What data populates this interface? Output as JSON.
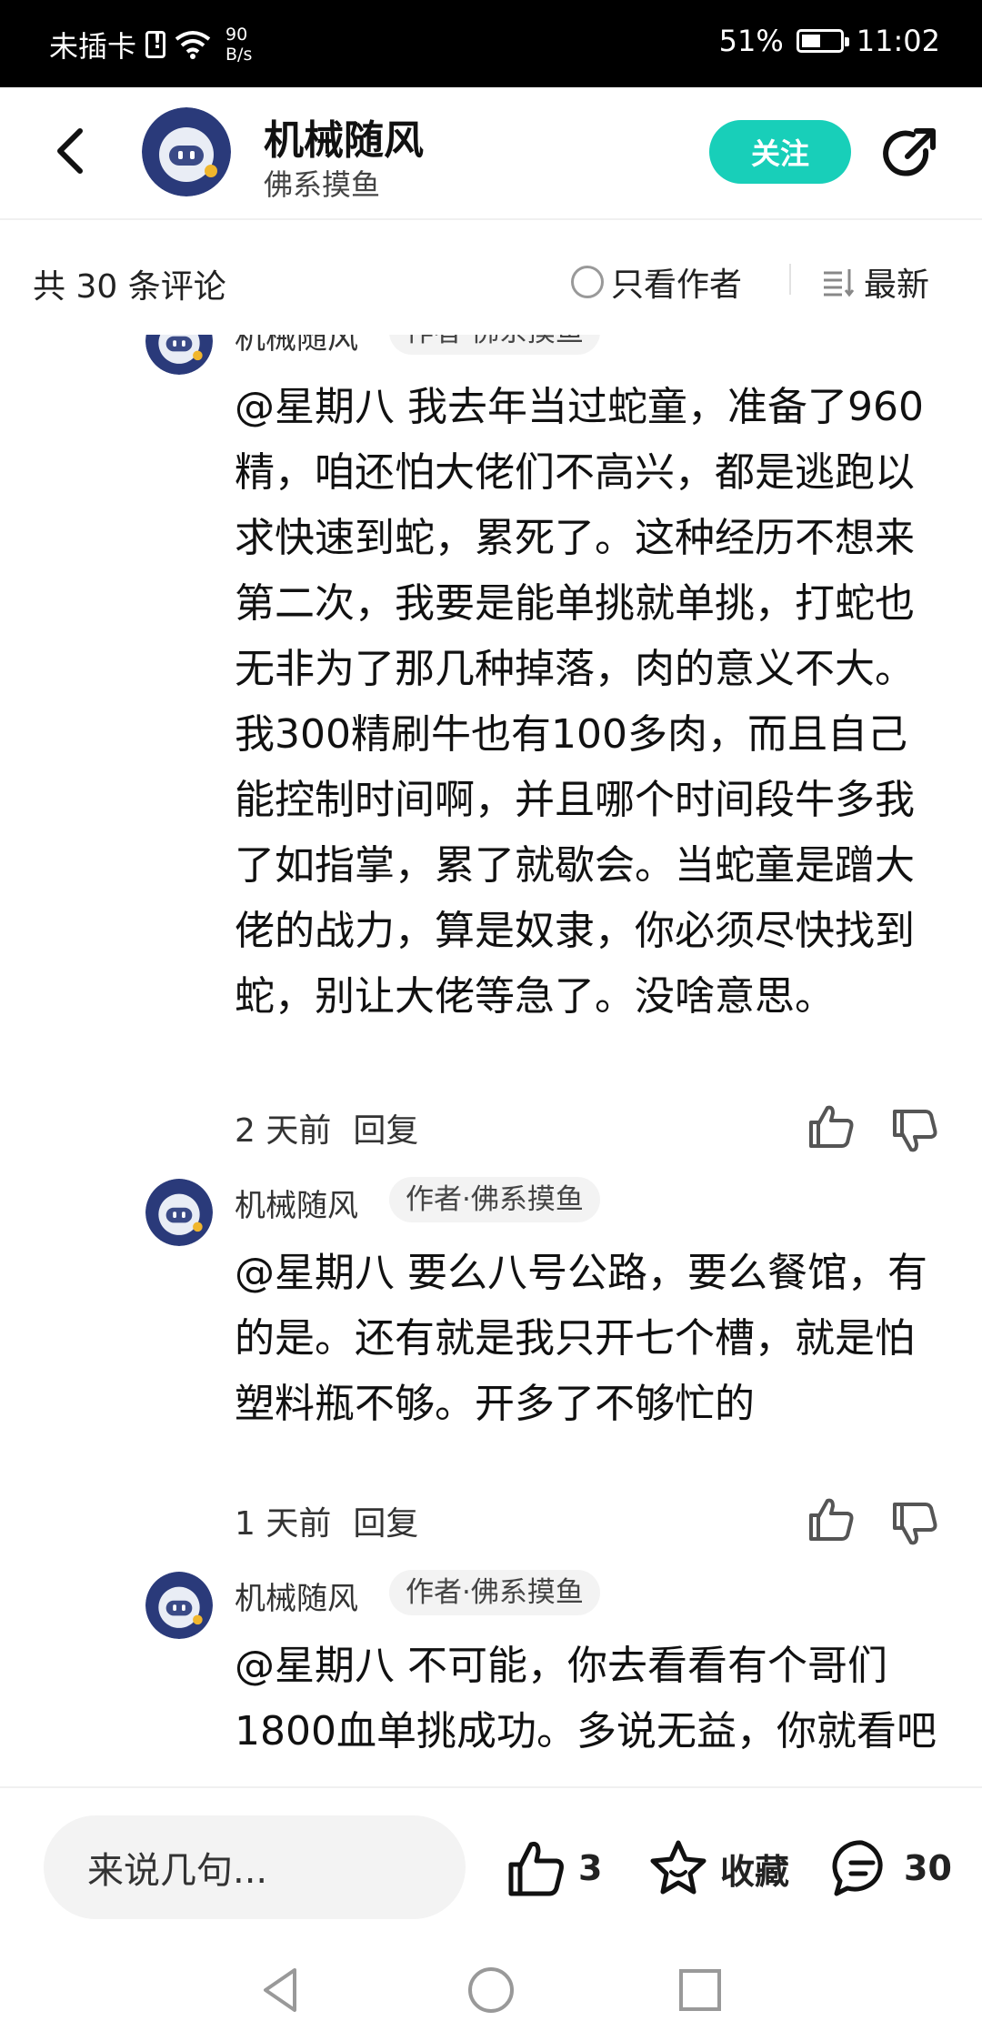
{
  "status_bar": {
    "carrier": "未插卡",
    "speed_value": "90",
    "speed_unit": "B/s",
    "battery": "51%",
    "time": "11:02"
  },
  "header": {
    "title": "机械随风",
    "subtitle": "佛系摸鱼",
    "follow_label": "关注"
  },
  "comments_header": {
    "count": "共 30 条评论",
    "author_only_label": "只看作者",
    "sort_label": "最新"
  },
  "replies": [
    {
      "name": "机械随风",
      "tag": "作者·佛系摸鱼",
      "text": "@星期八  我去年当过蛇童，准备了960精，咱还怕大佬们不高兴，都是逃跑以求快速到蛇，累死了。这种经历不想来第二次，我要是能单挑就单挑，打蛇也无非为了那几种掉落，肉的意义不大。我300精刷牛也有100多肉，而且自己能控制时间啊，并且哪个时间段牛多我了如指掌，累了就歇会。当蛇童是蹭大佬的战力，算是奴隶，你必须尽快找到蛇，别让大佬等急了。没啥意思。",
      "time": "2 天前",
      "reply_label": "回复"
    },
    {
      "name": "机械随风",
      "tag": "作者·佛系摸鱼",
      "text": "@星期八  要么八号公路，要么餐馆，有的是。还有就是我只开七个槽，就是怕塑料瓶不够。开多了不够忙的",
      "time": "1 天前",
      "reply_label": "回复"
    },
    {
      "name": "机械随风",
      "tag": "作者·佛系摸鱼",
      "text": "@星期八  不可能，你去看看有个哥们1800血单挑成功。多说无益，你就看吧"
    }
  ],
  "bottom_bar": {
    "input_placeholder": "来说几句...",
    "like_count": "3",
    "collect_label": "收藏",
    "comment_count": "30"
  }
}
